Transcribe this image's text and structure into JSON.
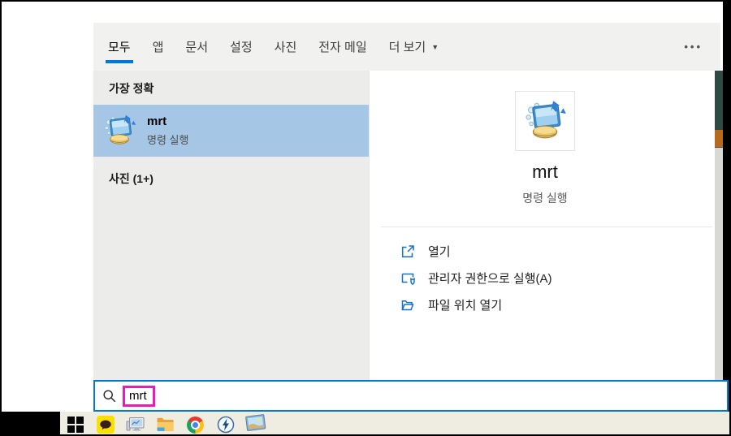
{
  "tabs_bar": {
    "tabs": [
      {
        "label": "모두",
        "active": true
      },
      {
        "label": "앱",
        "active": false
      },
      {
        "label": "문서",
        "active": false
      },
      {
        "label": "설정",
        "active": false
      },
      {
        "label": "사진",
        "active": false
      },
      {
        "label": "전자 메일",
        "active": false
      },
      {
        "label": "더 보기",
        "active": false
      }
    ],
    "more_dropdown_glyph": "▼",
    "overflow_glyph": "•••"
  },
  "left_panel": {
    "best_match_header": "가장 정확",
    "best_match": {
      "title": "mrt",
      "subtitle": "명령 실행"
    },
    "group_header": "사진 (1+)"
  },
  "right_panel": {
    "title": "mrt",
    "subtitle": "명령 실행",
    "actions": [
      {
        "label": "열기",
        "icon": "open-icon"
      },
      {
        "label": "관리자 권한으로 실행(A)",
        "icon": "admin-shield-icon"
      },
      {
        "label": "파일 위치 열기",
        "icon": "file-location-icon"
      }
    ]
  },
  "search_box": {
    "value": "mrt"
  },
  "taskbar": {
    "icons": [
      "windows-start",
      "kakaotalk",
      "pc-monitor",
      "file-explorer",
      "chrome",
      "lightning-app",
      "photo-viewer"
    ]
  },
  "colors": {
    "accent_blue": "#0078d7",
    "selected_item_bg": "#a5c6e5",
    "highlight_magenta": "#e81cb8",
    "tabbar_bg": "#f1f1f0",
    "left_panel_bg": "#ececeb",
    "taskbar_bg": "#efece1"
  }
}
